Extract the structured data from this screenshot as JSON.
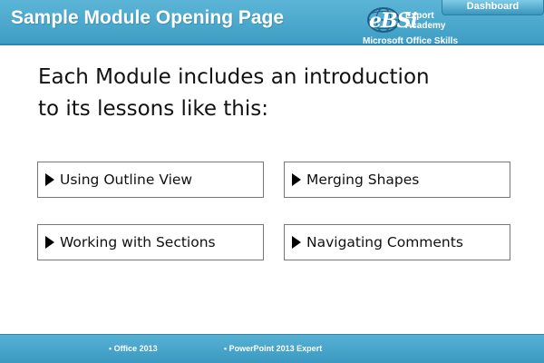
{
  "header": {
    "title": "Sample Module Opening Page",
    "dashboard_label": "Dashboard",
    "logo": {
      "brand": "eBSi",
      "line1": "Export",
      "line2": "Academy",
      "subtitle": "Microsoft Office Skills"
    }
  },
  "main": {
    "intro_line1": "Each Module includes an introduction",
    "intro_line2": "to its lessons like this:",
    "lessons": [
      {
        "label": "Using Outline View"
      },
      {
        "label": "Merging Shapes"
      },
      {
        "label": "Working with Sections"
      },
      {
        "label": "Navigating Comments"
      }
    ]
  },
  "footer": {
    "items": [
      "• Office 2013",
      "• PowerPoint 2013 Expert"
    ]
  },
  "colors": {
    "header_bar": "#3e9dc4",
    "footer_bar": "#3b99c1",
    "text": "#111111"
  }
}
